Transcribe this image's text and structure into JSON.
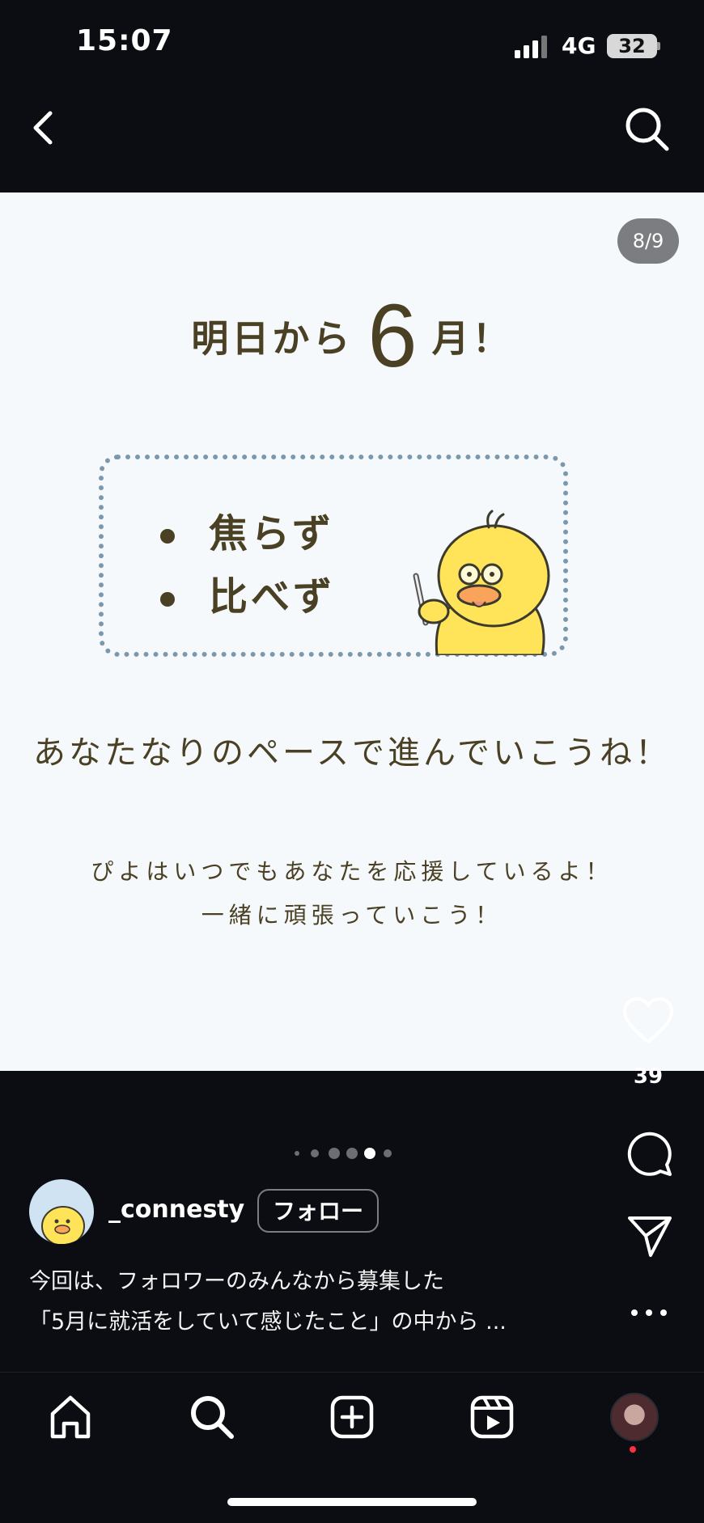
{
  "status_bar": {
    "time": "15:07",
    "network": "4G",
    "battery": "32"
  },
  "post": {
    "page_counter": "8/9",
    "headline": {
      "pre": "明日から",
      "big": "6",
      "post": "月！"
    },
    "tips": [
      "焦らず",
      "比べず"
    ],
    "subline": "あなたなりのペースで進んでいこうね！",
    "cheer": [
      "ぴよはいつでもあなたを応援しているよ！",
      "一緒に頑張っていこう！"
    ]
  },
  "actions": {
    "like_count": "39"
  },
  "author": {
    "username": "_connesty",
    "follow_label": "フォロー"
  },
  "caption": [
    "今回は、フォロワーのみんなから募集した",
    "「5月に就活をしていて感じたこと」の中から ..."
  ],
  "carousel": {
    "total": 6,
    "active": 4
  },
  "icons": {
    "back": "chevron-left-icon",
    "search": "search-icon",
    "like": "heart-icon",
    "comment": "comment-icon",
    "share": "send-icon",
    "more": "more-icon",
    "home": "home-icon",
    "create": "plus-square-icon",
    "reels": "reels-icon"
  },
  "colors": {
    "background": "#0b0d12",
    "post_bg": "#f6f9fc",
    "text_brown": "#4a4023",
    "box_border": "#7c98ad",
    "chick_yellow": "#ffe45a",
    "beak_orange": "#f9a35b"
  }
}
